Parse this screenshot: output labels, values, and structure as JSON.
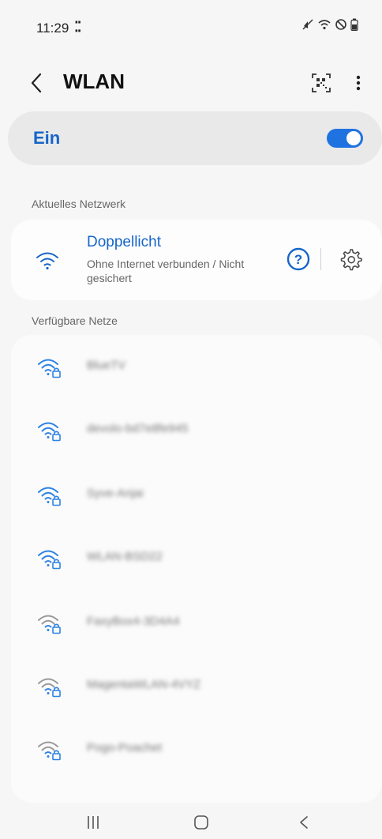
{
  "status_bar": {
    "time": "11:29",
    "notif_dots": "⁚⁚"
  },
  "header": {
    "title": "WLAN"
  },
  "master_toggle": {
    "label": "Ein",
    "on": true,
    "accent": "#1f73e0"
  },
  "sections": {
    "current": "Aktuelles Netzwerk",
    "available": "Verfügbare Netze"
  },
  "current_network": {
    "name": "Doppellicht",
    "status": "Ohne Internet verbunden / Nicht gesichert",
    "icons": [
      "wifi-icon",
      "help-icon",
      "gear-icon"
    ]
  },
  "available_networks": [
    {
      "name": "BlueTV"
    },
    {
      "name": "devolo-bd7e8fe945"
    },
    {
      "name": "Syve-Anjai"
    },
    {
      "name": "WLAN-BSD22"
    },
    {
      "name": "FaxyBox4-3D4A4"
    },
    {
      "name": "MagentaWLAN-4VYZ"
    },
    {
      "name": "Pogo-Poachet"
    }
  ],
  "nav": {
    "recents": "recents-icon",
    "home": "home-icon",
    "back": "back-icon"
  }
}
